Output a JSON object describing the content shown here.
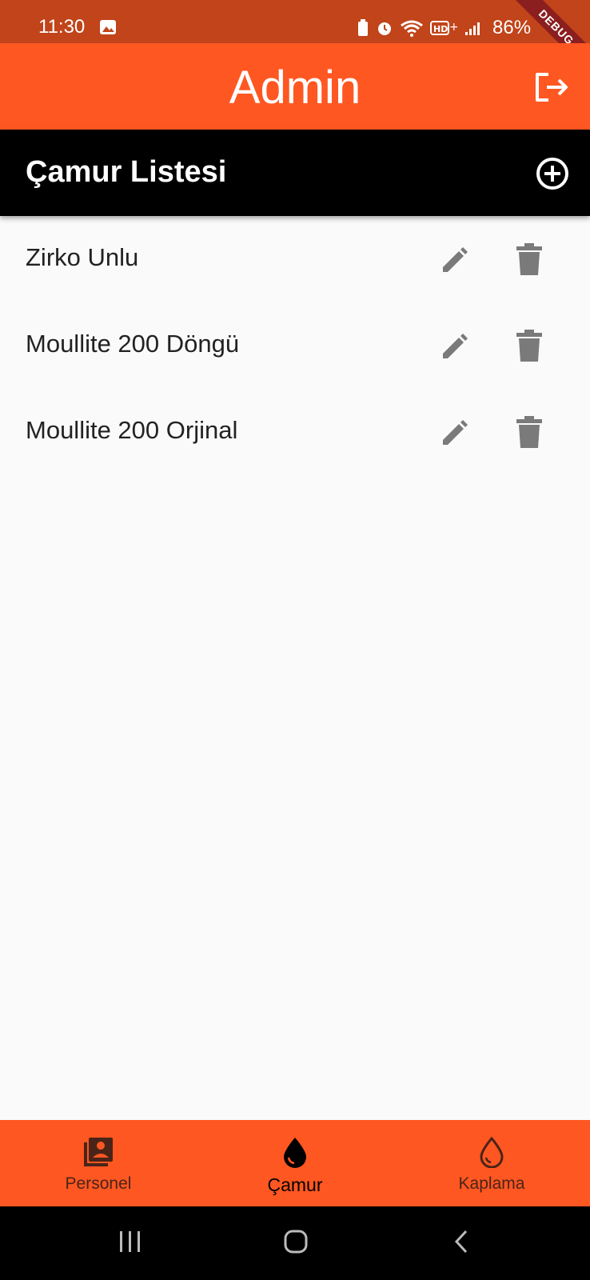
{
  "status_bar": {
    "time": "11:30",
    "battery": "86%",
    "debug_label": "DEBUG"
  },
  "app_bar": {
    "title": "Admin",
    "logout_icon": "logout-icon"
  },
  "section": {
    "title": "Çamur Listesi",
    "add_icon": "add-circle-icon"
  },
  "list": {
    "items": [
      {
        "label": "Zirko Unlu"
      },
      {
        "label": "Moullite 200 Döngü"
      },
      {
        "label": "Moullite 200 Orjinal"
      }
    ]
  },
  "bottom_nav": {
    "items": [
      {
        "label": "Personel",
        "icon": "personnel-icon",
        "active": false
      },
      {
        "label": "Çamur",
        "icon": "drop-filled-icon",
        "active": true
      },
      {
        "label": "Kaplama",
        "icon": "drop-outline-icon",
        "active": false
      }
    ]
  },
  "colors": {
    "accent": "#ff5722",
    "status_bar": "#c1441a",
    "header_bg": "#000000",
    "icon_grey": "#7a7a7a"
  }
}
